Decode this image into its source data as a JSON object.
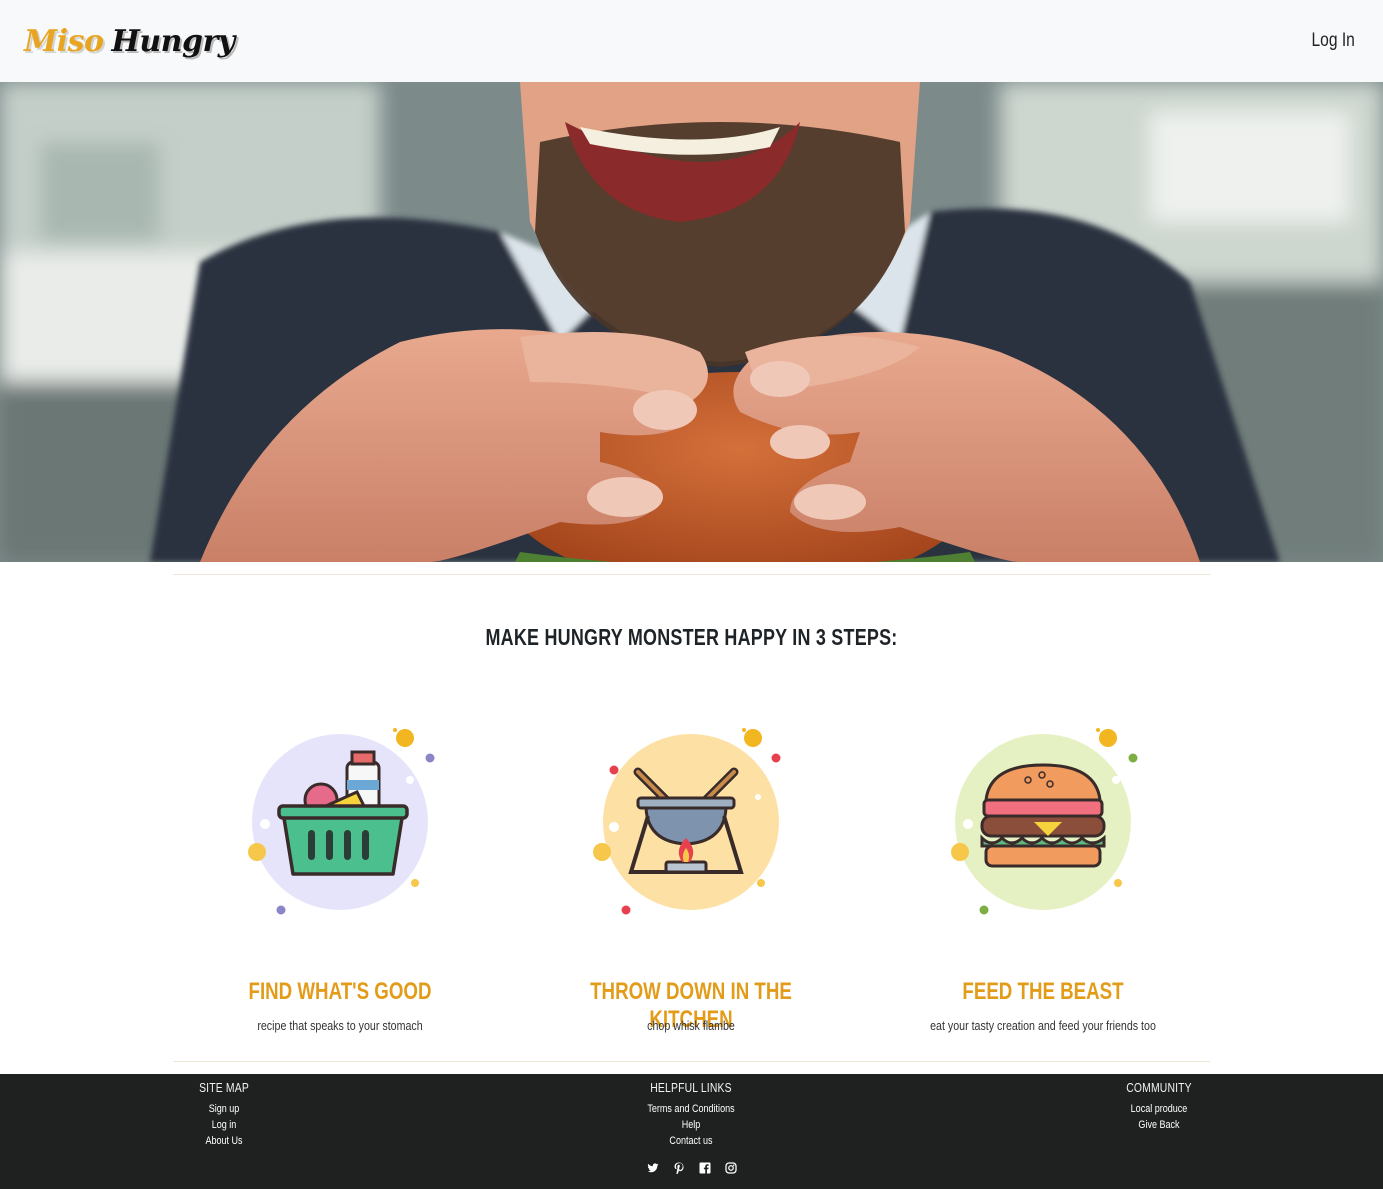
{
  "navbar": {
    "brand_first": "Miso",
    "brand_second": "Hungry",
    "login": "Log In"
  },
  "hero": {
    "image": "photo of a smiling bearded man biting a burger"
  },
  "steps": {
    "heading": "Make Hungry Monster Happy in 3 Steps:",
    "items": [
      {
        "icon": "grocery-basket-icon",
        "title": "Find What's Good",
        "desc": "recipe that speaks to your stomach",
        "bg": "#e6e4fb"
      },
      {
        "icon": "cooking-pot-icon",
        "title": "Throw Down in the Kitchen",
        "desc": "chop whisk flambe",
        "bg": "#fde0a3"
      },
      {
        "icon": "burger-icon",
        "title": "Feed the Beast",
        "desc": "eat your tasty creation and feed your friends too",
        "bg": "#e6f1c3"
      }
    ]
  },
  "footer": {
    "site_map": {
      "title": "Site Map",
      "links": [
        "Sign up",
        "Log in",
        "About Us"
      ]
    },
    "helpful": {
      "title": "Helpful Links",
      "links": [
        "Terms and Conditions",
        "Help",
        "Contact us"
      ]
    },
    "community": {
      "title": "Community",
      "links": [
        "Local produce",
        "Give Back"
      ]
    },
    "social": [
      "twitter-icon",
      "pinterest-icon",
      "facebook-icon",
      "instagram-icon"
    ]
  },
  "colors": {
    "accent": "#e39c1a",
    "footer_bg": "#1f2120",
    "navbar_bg": "#f8f9fa"
  }
}
